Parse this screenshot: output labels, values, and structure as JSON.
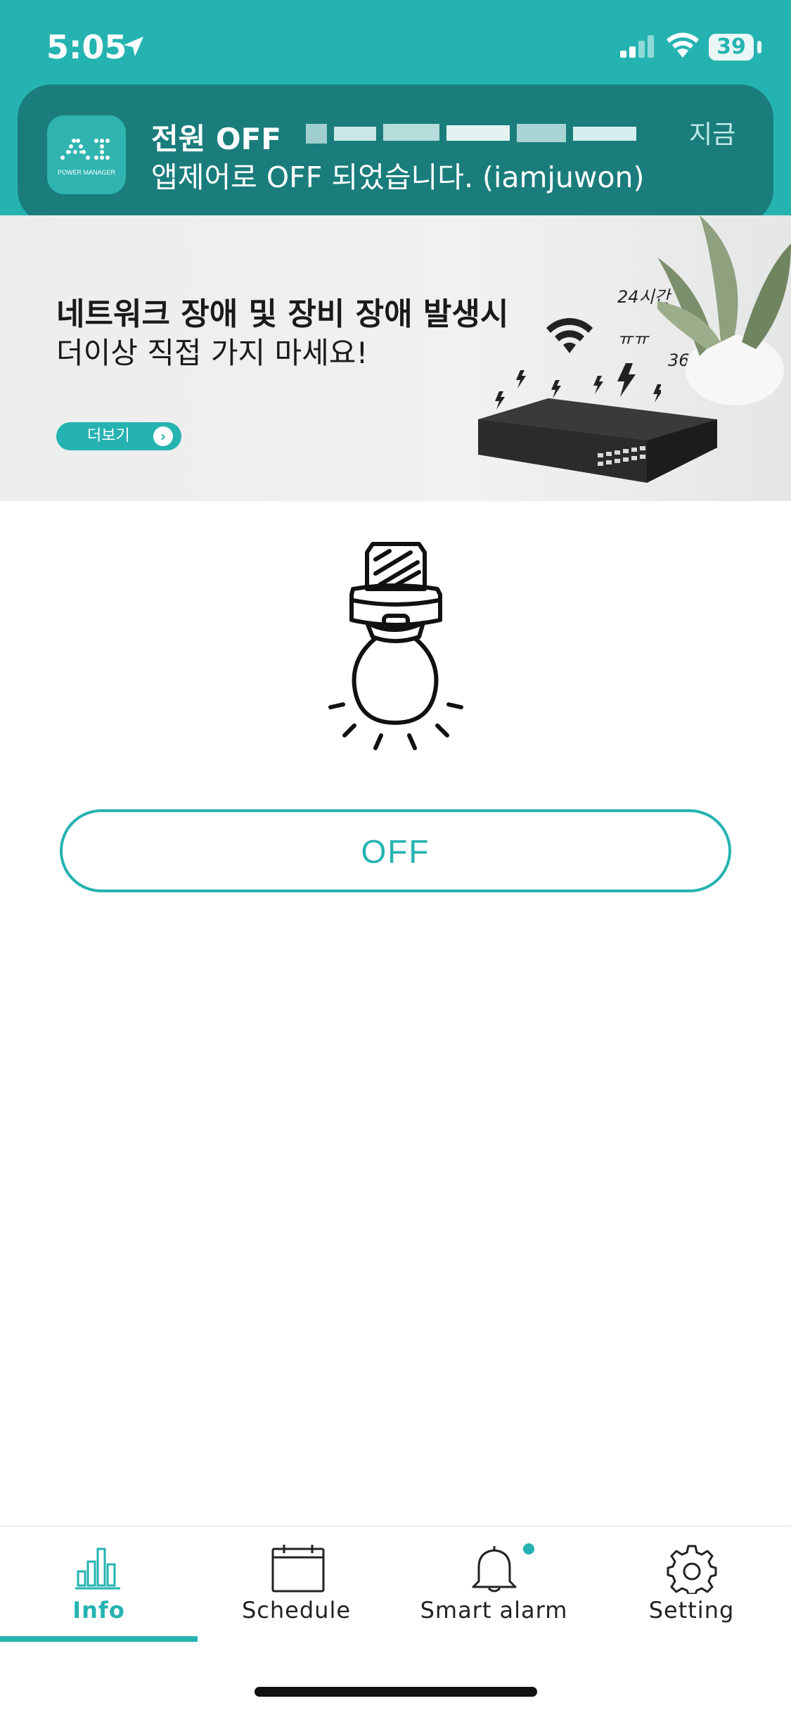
{
  "status_bar": {
    "time": "5:05",
    "battery": "39"
  },
  "notification": {
    "title": "전원 OFF",
    "body": "앱제어로 OFF 되었습니다. (iamjuwon)",
    "time": "지금",
    "app_icon_text": "AI",
    "app_icon_subtext": "POWER MANAGER"
  },
  "banner": {
    "title": "네트워크 장애 및 장비 장애 발생시",
    "subtitle": "더이상 직접 가지 마세요!",
    "more_label": "더보기",
    "annotations": {
      "hours": "24시간",
      "crying": "ㅠㅠ",
      "days": "365일"
    }
  },
  "device": {
    "power_state": "OFF"
  },
  "tabs": [
    {
      "label": "Info",
      "active": true
    },
    {
      "label": "Schedule",
      "active": false
    },
    {
      "label": "Smart alarm",
      "active": false
    },
    {
      "label": "Setting",
      "active": false
    }
  ],
  "colors": {
    "accent": "#25b3b1",
    "notification_bg": "#1a7d7c"
  }
}
